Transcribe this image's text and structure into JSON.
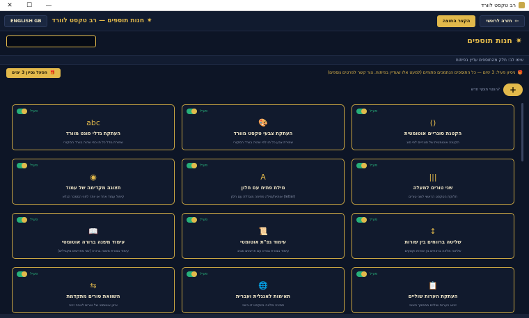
{
  "titlebar": {
    "title": "רב טקסט לוורד",
    "min": "—",
    "max": "☐",
    "close": "✕"
  },
  "header": {
    "lang_button": "ENGLISH GB",
    "title": "חנות תוספים — רב טקסט לוורד",
    "shortcut_button": "הקצר החוצה",
    "home_button": "חזרה לראשי"
  },
  "search": {
    "value": ""
  },
  "page_title": "חנות תוספים",
  "tip": "שימו לב: חלק מהתוספים עדיין בפיתוח",
  "trial": {
    "message": "ניסיון פעיל: 3 ימים — כל התוספים הנתמכים פתוחים (למעט אלו שעדיין בפיתוח. צור קשר לפרטים נוספים)",
    "button": "הפעל נסיון 3 ימים"
  },
  "add": {
    "hint": "הוסף תוסף חדש?",
    "button": "+"
  },
  "cards": [
    {
      "toggle_label": "פעיל",
      "icon": "()",
      "icon_name": "parentheses-icon",
      "title": "הקטנת סוגריים אוטומטית",
      "desc": "הקטנה אוטומטית של סוגריים לפי סוג"
    },
    {
      "toggle_label": "פעיל",
      "icon": "🎨",
      "icon_name": "palette-icon",
      "title": "העתקת צבעי טקסט מוורד",
      "desc": "שמירת צבע כל תו לפי שהיה בוורד המקורי"
    },
    {
      "toggle_label": "פעיל",
      "icon": "abc",
      "icon_name": "font-size-icon",
      "title": "העתקת גדלי פונט מוורד",
      "desc": "שמירת גודל כל תו כפי שהיה בוורד המקורי"
    },
    {
      "toggle_label": "פעיל",
      "icon": "|||",
      "icon_name": "columns-icon",
      "title": "שני טורים למעלה",
      "desc": "חלוקת הטקסט הראשי לשני טורים"
    },
    {
      "toggle_label": "פעיל",
      "icon": "A",
      "icon_name": "letter-a-icon",
      "title": "מילת פתיח עם חלון",
      "desc": "אותיות/מילה פתיחה מוגדלת עם חלון (letter)"
    },
    {
      "toggle_label": "פעיל",
      "icon": "◉",
      "icon_name": "eye-icon",
      "title": "תצוגה מקדימה של עמוד",
      "desc": "קיפול עמוד אחד או יותר לפני הסמכר הגלא"
    },
    {
      "toggle_label": "פעיל",
      "icon": "↕",
      "icon_name": "arrows-vertical-icon",
      "title": "שליטה ברווחים בין שורות",
      "desc": "שליטה מלאה ברווחים בין שורות וקטעים"
    },
    {
      "toggle_label": "פעיל",
      "icon": "📜",
      "icon_name": "scroll-icon",
      "title": "עימוד גפ\"ת אוטומטי",
      "desc": "עימוד בצורת גמרא עם פרשנים סביב"
    },
    {
      "toggle_label": "פעיל",
      "icon": "📖",
      "icon_name": "book-icon",
      "title": "עימוד משנה ברורה אוטומטי",
      "desc": "עימוד בצורת משנה ברורה (שני מפרשים מקבילים)"
    },
    {
      "toggle_label": "פעיל",
      "icon": "📋",
      "icon_name": "clipboard-icon",
      "title": "העתקת הערות שוליים",
      "desc": "ייבוא הערות שוליים ממסמך חיצוני"
    },
    {
      "toggle_label": "פעיל",
      "icon": "🌐",
      "icon_name": "globe-icon",
      "title": "תאימות לאנגלית ועברית",
      "desc": "תמיכה מלאה בטקסט דו-כיווני"
    },
    {
      "toggle_label": "פעיל",
      "icon": "⇆",
      "icon_name": "swap-arrows-icon",
      "title": "השוואת טורים מתקדמת",
      "desc": "איזון אוטומטי של טורים לגובה זהה"
    }
  ],
  "colors": {
    "accent": "#e2b94b",
    "background": "#0d1526",
    "card": "#111a2d",
    "active": "#27b07a"
  }
}
